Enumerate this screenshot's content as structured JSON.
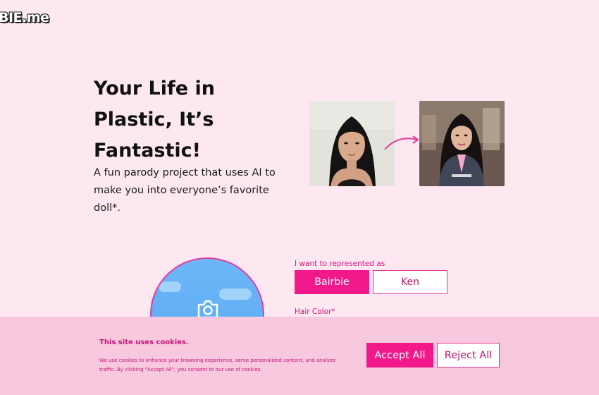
{
  "header": {
    "logo_text": "BIE.me"
  },
  "hero": {
    "title_line1": "Your Life in",
    "title_line2": "Plastic, It’s",
    "title_line3": "Fantastic!",
    "subtitle": "A fun parody project that uses AI to make you into everyone’s favorite doll*."
  },
  "form": {
    "represent_label": "I want to represented as",
    "options": [
      "Bairbie",
      "Ken"
    ],
    "selected": "Bairbie",
    "hair_color_label": "Hair Color*"
  },
  "cookie_banner": {
    "title": "This site uses cookies.",
    "text": "We use cookies to enhance your browsing experience, serve personalized content, and analyze traffic. By clicking \"Accept All\", you consent to our use of cookies.",
    "accept_label": "Accept All",
    "reject_label": "Reject All"
  },
  "colors": {
    "background": "#fde8f2",
    "primary": "#f0188a",
    "banner": "#f8c8de",
    "text_accent": "#c8127a"
  },
  "icons": [
    "camera-icon",
    "arrow-icon"
  ]
}
